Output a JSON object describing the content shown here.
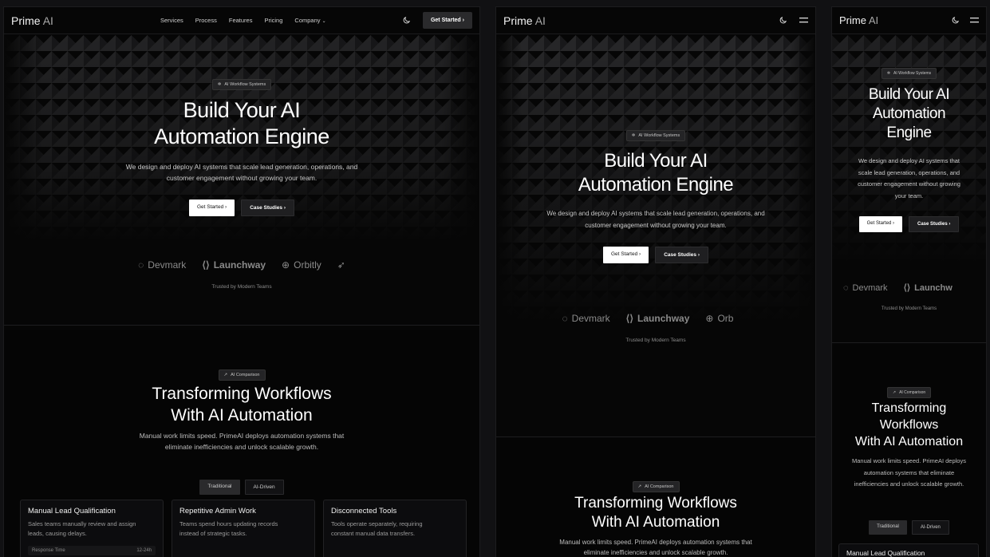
{
  "brand": {
    "name": "Prime",
    "suffix": "AI"
  },
  "nav": {
    "links": [
      "Services",
      "Process",
      "Features",
      "Pricing",
      "Company"
    ],
    "cta": "Get Started"
  },
  "hero": {
    "badge": "AI Workflow Systems",
    "title_line1": "Build Your AI",
    "title_line2": "Automation Engine",
    "subtitle_line1": "We design and deploy AI systems that scale lead generation, operations, and",
    "subtitle_line2": "customer engagement without growing your team.",
    "subtitle_p3": [
      "We design and deploy AI systems that",
      "scale lead generation, operations, and",
      "customer engagement without growing",
      "your team."
    ],
    "primary_button": "Get Started",
    "secondary_button": "Case Studies",
    "logos": [
      "Devmark",
      "Launchway",
      "Orbitly"
    ],
    "logos_cut": [
      "Orb",
      "Launchw"
    ],
    "trusted": "Trusted by Modern Teams"
  },
  "comparison": {
    "badge": "AI Comparison",
    "title_line1": "Transforming Workflows",
    "title_line2": "With AI Automation",
    "title_p3": [
      "Transforming",
      "Workflows",
      "With AI Automation"
    ],
    "desc_line1": "Manual work limits speed. PrimeAI deploys automation systems that",
    "desc_line2": "eliminate inefficiencies and unlock scalable growth.",
    "desc_p3": [
      "Manual work limits speed. PrimeAI deploys",
      "automation systems that eliminate",
      "inefficiencies and unlock scalable growth."
    ],
    "tabs": [
      "Traditional",
      "AI-Driven"
    ],
    "cards": [
      {
        "title": "Manual Lead Qualification",
        "desc_line1": "Sales teams manually review and assign",
        "desc_line2": "leads, causing delays.",
        "metric_label": "Response Time",
        "metric_value": "12-24h"
      },
      {
        "title": "Repetitive Admin Work",
        "desc_line1": "Teams spend hours updating records",
        "desc_line2": "instead of strategic tasks."
      },
      {
        "title": "Disconnected Tools",
        "desc_line1": "Tools operate separately, requiring",
        "desc_line2": "constant manual data transfers."
      }
    ],
    "card_p3_cut": "Manual Lead Qualification"
  }
}
